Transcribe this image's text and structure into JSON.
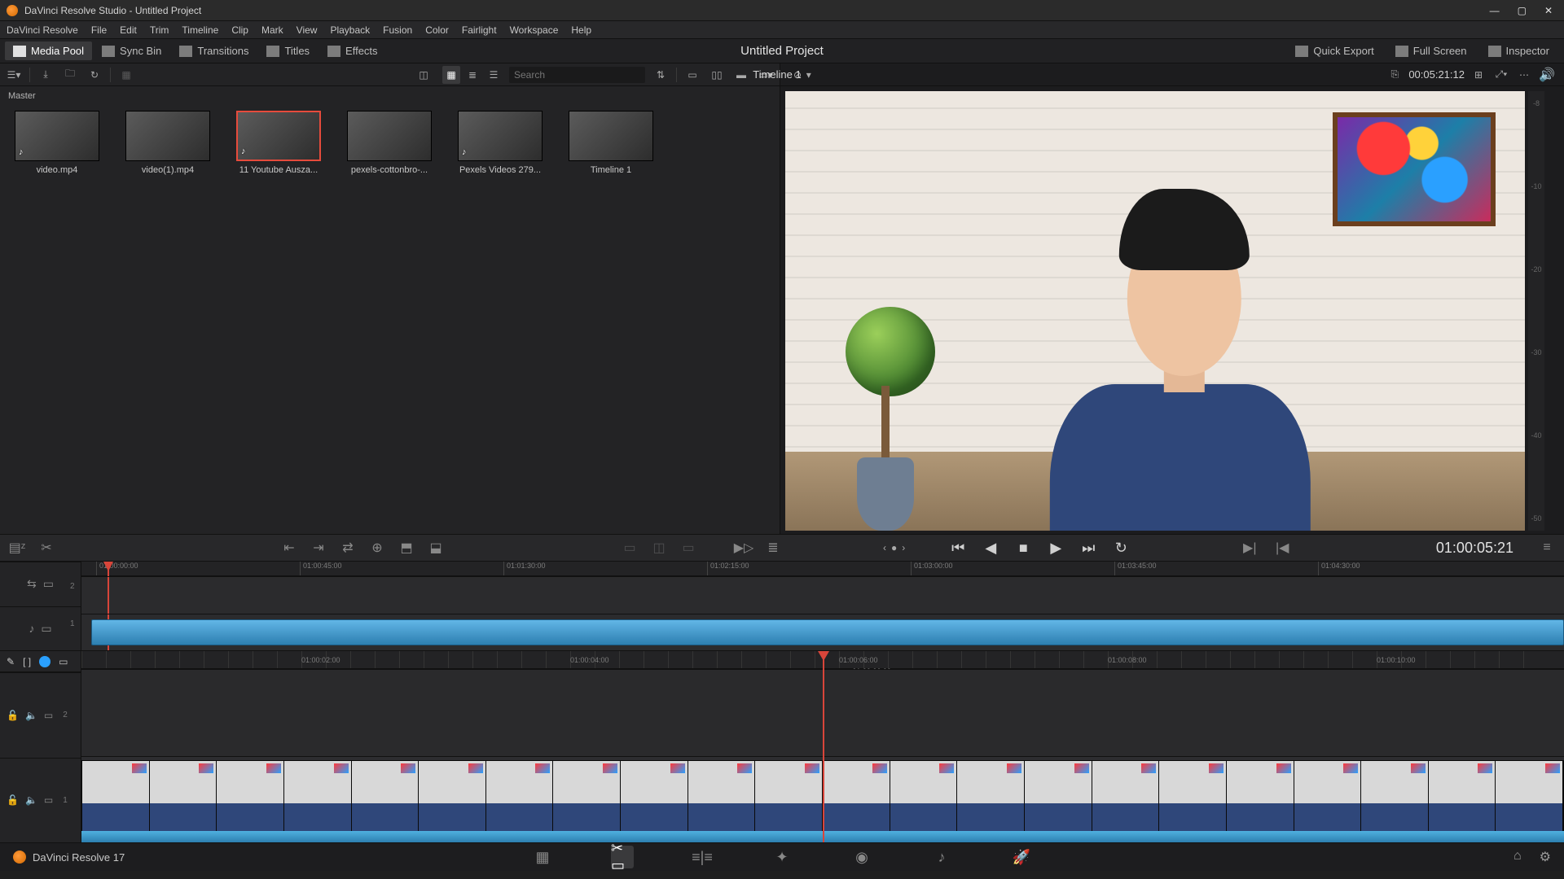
{
  "window": {
    "title": "DaVinci Resolve Studio - Untitled Project",
    "minimize_icon": "minimize-icon",
    "maximize_icon": "maximize-icon",
    "close_icon": "close-icon"
  },
  "menubar": [
    "DaVinci Resolve",
    "File",
    "Edit",
    "Trim",
    "Timeline",
    "Clip",
    "Mark",
    "View",
    "Playback",
    "Fusion",
    "Color",
    "Fairlight",
    "Workspace",
    "Help"
  ],
  "toolbar": {
    "media_pool": "Media Pool",
    "sync_bin": "Sync Bin",
    "transitions": "Transitions",
    "titles": "Titles",
    "effects": "Effects",
    "project_title": "Untitled Project",
    "quick_export": "Quick Export",
    "full_screen": "Full Screen",
    "inspector": "Inspector"
  },
  "media_pool": {
    "folder": "Master",
    "search_placeholder": "Search",
    "clips": [
      {
        "label": "video.mp4",
        "audio": true
      },
      {
        "label": "video(1).mp4",
        "audio": false
      },
      {
        "label": "11 Youtube Ausza...",
        "audio": true,
        "selected": true
      },
      {
        "label": "pexels-cottonbro-...",
        "audio": false
      },
      {
        "label": "Pexels Videos 279...",
        "audio": true
      },
      {
        "label": "Timeline 1",
        "audio": false
      }
    ]
  },
  "viewer": {
    "timeline_name": "Timeline 1",
    "source_tc": "00:05:21:12",
    "record_tc": "01:00:05:21"
  },
  "tape": {
    "ruler": [
      "01:00:00:00",
      "01:00:45:00",
      "01:01:30:00",
      "01:02:15:00",
      "01:03:00:00",
      "01:03:45:00",
      "01:04:30:00"
    ],
    "track_nums": [
      "2",
      "1"
    ]
  },
  "detail": {
    "ruler": [
      "01:00:02:00",
      "01:00:04:00",
      "01:00:06:00",
      "01:00:08:00",
      "01:00:10:00"
    ],
    "cursor_tc": "01:00:06:00",
    "track_nums": [
      "2",
      "1"
    ]
  },
  "pagetabs": {
    "label": "DaVinci Resolve 17"
  }
}
